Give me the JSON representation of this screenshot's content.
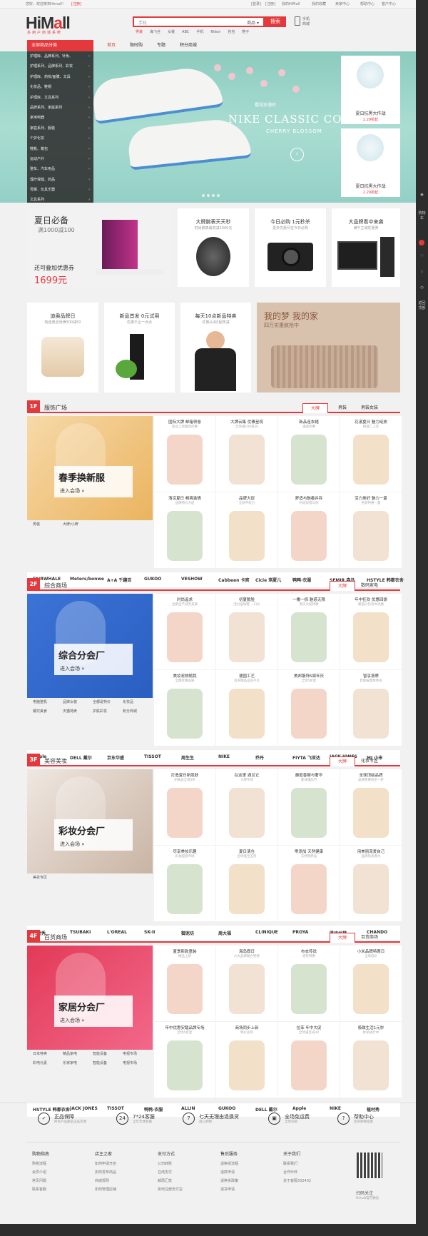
{
  "topbar": {
    "greet": "您好，欢迎来到Himall！",
    "login_link": "[登录]",
    "register_link": "[注册]",
    "my_account": "我的HiMall",
    "fav": "我的收藏",
    "merchant": "卖家中心",
    "help": "帮助中心",
    "more": "客户中心"
  },
  "header": {
    "logo_main": "HiM",
    "logo_r": "a",
    "logo_tail": "ll",
    "logo_sub": "多用户商城系统",
    "search_placeholder": "手机",
    "search_category": "商品 ▾",
    "search_button": "搜索",
    "hot_words": [
      "男装",
      "海飞丝",
      "女装",
      "ABC",
      "手机",
      "Nikon",
      "包包",
      "鞋子"
    ],
    "phone_label": "手机商城"
  },
  "nav": {
    "category_head": "全部商品分类",
    "links": [
      "首页",
      "限时购",
      "专题",
      "积分商城"
    ]
  },
  "categories": [
    "护理库、品牌系列、针免、",
    "护理系列、品牌系列、彩妆",
    "护理库、药妆/面膜、文具",
    "化妆品、鞋帽",
    "护理库、文具系列",
    "品牌系列、家庭系列",
    "家用电器",
    "家庭系列、服装",
    "个护化妆",
    "鞋靴、箱包",
    "运动户外",
    "整车、汽车用品",
    "理疗保健、药品",
    "母婴、玩具乐器",
    "文具系列"
  ],
  "banner": {
    "line1": "樱花狂漫时",
    "line2": "NIKE CLASSIC COR",
    "line3": "CHERRY BLOSSOM"
  },
  "side_ads": [
    {
      "title": "夏日抗黑大作战",
      "price": "2.29折起"
    },
    {
      "title": "夏日抗黑大作战",
      "price": "2.29折起"
    }
  ],
  "promo_row1": [
    {
      "title": "夏日必备",
      "sub": "满1000减100",
      "tag": "还可叠加优惠券",
      "price": "1699元"
    },
    {
      "title": "大牌腕表天天秒",
      "sub": "时尚腕表最高减1000元"
    },
    {
      "title": "今日必购 1元秒杀",
      "sub": "更多优惠尽在今日必购"
    },
    {
      "title": "大品牌看中来袭",
      "sub": "满千立减优惠券"
    }
  ],
  "promo_row2": [
    {
      "title": "迪奥品牌日",
      "sub": "购迪奥全场满300减50"
    },
    {
      "title": "新品首发 0元试用",
      "sub": "优惠不止一点点"
    },
    {
      "title": "每天10点新品特卖",
      "sub": "优惠从4折起再减"
    },
    {
      "title": "我的梦 我的家",
      "sub": "四万实惠疯抢中"
    }
  ],
  "sec1": {
    "num": "1F",
    "title": "服饰广场",
    "tabs": [
      "大牌",
      "男装",
      "男装女装"
    ],
    "promo_title": "春季换新服",
    "promo_enter": "进入会场 »",
    "links": [
      "男装",
      "大牌/小牌"
    ],
    "cells": [
      {
        "t": "国际大牌 邮箱领卷",
        "s": "新品上架最高优惠"
      },
      {
        "t": "大牌云集 优雅呈现",
        "s": "全场满100减30"
      },
      {
        "t": "新品连衣裙",
        "s": "满减优惠"
      },
      {
        "t": "花漾夏日 魅力绽放",
        "s": "每满二上衣"
      },
      {
        "t": "清凉夏日 畅爽激情",
        "s": "品牌特价大促"
      },
      {
        "t": "品牌大促",
        "s": "全场不给力"
      },
      {
        "t": "舒适与魅奏并存",
        "s": "时尚穿搭与你"
      },
      {
        "t": "活力美好 魅力一夏",
        "s": "男装特惠一夏"
      }
    ],
    "brands": [
      "FAIRWHALE",
      "Meters/bonwe",
      "A+A 千趣百",
      "GUKOO",
      "VESHOW",
      "Cabbeen 卡宾",
      "Cicie 琪夏儿",
      "鸭鸭·衣服",
      "SEMIR 森马",
      "HSTYLE 韩都衣舍"
    ]
  },
  "sec2": {
    "num": "2F",
    "title": "综合商场",
    "tabs": [
      "大牌",
      "数码家电"
    ],
    "promo_title": "综合分会厂",
    "promo_enter": "进入会场 »",
    "links": [
      "电脑整机",
      "品牌女装",
      "全都是特价",
      "化妆品",
      "餐饮美食",
      "天猫特卖",
      "护肤彩妆",
      "积分商城"
    ],
    "cells": [
      {
        "t": "时尚追求",
        "s": "全都全不减无美丽"
      },
      {
        "t": "初夏脆脸",
        "s": "活力运动鞋 一口价"
      },
      {
        "t": "一撇一捺 魅惑无限",
        "s": "黑白大促特惠"
      },
      {
        "t": "年中狂欢 优惠回馈",
        "s": "最低价仍有大优惠"
      },
      {
        "t": "美妆宠物随我",
        "s": "全都优惠美丽"
      },
      {
        "t": "德国工艺",
        "s": "追求精品追品不凡"
      },
      {
        "t": "美邦服饰5周年庆",
        "s": "全场5折起"
      },
      {
        "t": "智享按摩",
        "s": "智能按摩更休闲"
      }
    ],
    "brands": [
      "Apple",
      "DELL 戴尔",
      "京东华盛",
      "TISSOT",
      "周生生",
      "NIKE",
      "乔丹",
      "FIYTA 飞亚达",
      "JACK JONES",
      "MI 小米"
    ]
  },
  "sec3": {
    "num": "3F",
    "title": "美容美妆",
    "tabs": [
      "大牌",
      "化妆专区"
    ],
    "promo_title": "彩妆分会厂",
    "promo_enter": "进入会场 »",
    "links": [
      "美妆专区"
    ],
    "cells": [
      {
        "t": "打造夏日新肌肤",
        "s": "护肤品全场5折"
      },
      {
        "t": "在这里 遇见它",
        "s": "大牌专场"
      },
      {
        "t": "邂逅香榭与奢华",
        "s": "夏日臻品节"
      },
      {
        "t": "全球顶级品牌",
        "s": "品牌钜惠低至一折"
      },
      {
        "t": "尽享美妆乐趣",
        "s": "彩妆超值专场"
      },
      {
        "t": "夏日清仓",
        "s": "全场低至五折"
      },
      {
        "t": "零添加 天然健康",
        "s": "天然保养品"
      },
      {
        "t": "用美丽宠爱自己",
        "s": "品牌热卖香水"
      }
    ],
    "brands": [
      "植村秀",
      "TSUBAKI",
      "L'OREAL",
      "SK-II",
      "御泥坊",
      "周大福",
      "CLINIQUE",
      "PROYA",
      "雅诗兰黛",
      "CHANDO"
    ]
  },
  "sec4": {
    "num": "4F",
    "title": "百货商场",
    "tabs": [
      "大牌",
      "百货商场"
    ],
    "promo_title": "家居分会厂",
    "promo_enter": "进入会场 »",
    "links": [
      "日本特卖",
      "精品家电",
      "智能设备",
      "电视专场",
      "彩电元素",
      "乐家家电",
      "智能设备",
      "电视专场"
    ],
    "cells": [
      {
        "t": "夏季新款童装",
        "s": "精品上新"
      },
      {
        "t": "海岛假日",
        "s": "六大品牌联合钜惠"
      },
      {
        "t": "布衣传说",
        "s": "男装特惠"
      },
      {
        "t": "小米品牌特惠日",
        "s": "全场低价"
      },
      {
        "t": "年中优惠安踏品牌专场",
        "s": "全场5折起"
      },
      {
        "t": "商场同步上新",
        "s": "特价首饰"
      },
      {
        "t": "拉菲 年中大促",
        "s": "全场满百减30"
      },
      {
        "t": "极致生活1元秒",
        "s": "秒杀进行中"
      }
    ],
    "brands": [
      "HSTYLE 韩都衣舍",
      "JACK JONES",
      "TISSOT",
      "鸭鸭·衣服",
      "ALLIN",
      "GUKOO",
      "DELL 戴尔",
      "Apple",
      "NIKE",
      "植村秀"
    ]
  },
  "services": [
    {
      "icon": "✓",
      "t": "正品保障",
      "s": "所有产品都是正品货源"
    },
    {
      "icon": "24",
      "t": "7*24客服",
      "s": "全年无休客服"
    },
    {
      "icon": "7",
      "t": "七天无理由退换货",
      "s": "放心购物"
    },
    {
      "icon": "▣",
      "t": "全场免运费",
      "s": "全场包邮"
    },
    {
      "icon": "?",
      "t": "帮助中心",
      "s": "您的购物指南"
    }
  ],
  "footer": [
    {
      "h": "购物指南",
      "l": [
        "购物流程",
        "会员介绍",
        "常见问题",
        "联系客服"
      ]
    },
    {
      "h": "店主之家",
      "l": [
        "如何申请开店",
        "如何发布商品",
        "商城规则",
        "如何管理店铺"
      ]
    },
    {
      "h": "支付方式",
      "l": [
        "公司转账",
        "在线支付",
        "邮局汇款",
        "如何注册支付宝"
      ]
    },
    {
      "h": "售后服务",
      "l": [
        "退换货流程",
        "退款申请",
        "退换货政策",
        "退货申请"
      ]
    },
    {
      "h": "关于我们",
      "l": [
        "联系我们",
        "合作伙伴",
        "关于客服332432"
      ]
    }
  ],
  "qr": {
    "label": "扫码关注",
    "sub": "Himall官方微信"
  },
  "rbar": [
    "购物车",
    "我的收藏",
    "我的足迹",
    "返回顶部"
  ]
}
